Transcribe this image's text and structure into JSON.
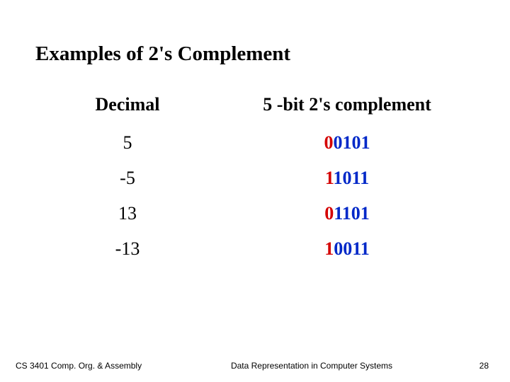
{
  "title": "Examples of 2's Complement",
  "headers": {
    "decimal": "Decimal",
    "binary": "5 -bit 2's complement"
  },
  "rows": [
    {
      "decimal": "5",
      "sign": "0",
      "rest": "0101"
    },
    {
      "decimal": "-5",
      "sign": "1",
      "rest": "1011"
    },
    {
      "decimal": "13",
      "sign": "0",
      "rest": "1101"
    },
    {
      "decimal": "-13",
      "sign": "1",
      "rest": "0011"
    }
  ],
  "footer": {
    "left": "CS 3401 Comp. Org. & Assembly",
    "center": "Data Representation in Computer Systems",
    "page": "28"
  },
  "chart_data": {
    "type": "table",
    "title": "Examples of 2's Complement",
    "columns": [
      "Decimal",
      "5-bit 2's complement"
    ],
    "rows": [
      [
        "5",
        "00101"
      ],
      [
        "-5",
        "11011"
      ],
      [
        "13",
        "01101"
      ],
      [
        "-13",
        "10011"
      ]
    ]
  }
}
